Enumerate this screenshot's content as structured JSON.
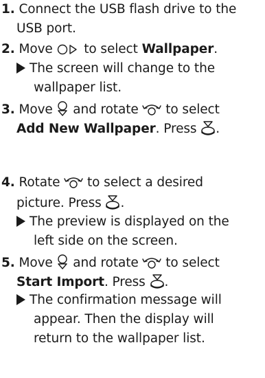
{
  "steps": [
    {
      "number": "1.",
      "line1": "Connect the USB flash drive to the",
      "line2": "USB port."
    },
    {
      "number": "2.",
      "text_before": "Move",
      "icon": "move-right-icon",
      "text_mid": "to select",
      "bold": "Wallpaper",
      "text_after": ".",
      "result_line1": "The screen will change to the",
      "result_line2": "wallpaper list."
    },
    {
      "number": "3.",
      "text_before": "Move",
      "icon1": "move-down-icon",
      "text_mid": "and rotate",
      "icon2": "rotate-icon",
      "text_after": "to select",
      "bold": "Add New Wallpaper",
      "text_press": ". Press",
      "icon3": "press-icon",
      "text_end": "."
    },
    {
      "number": "4.",
      "text_before": "Rotate",
      "icon": "rotate-icon",
      "text_after": "to select a desired",
      "line2_before": "picture. Press",
      "icon2": "press-icon",
      "line2_end": ".",
      "result_line1": "The preview is displayed on the",
      "result_line2": "left side on the screen."
    },
    {
      "number": "5.",
      "text_before": "Move",
      "icon1": "move-down-icon",
      "text_mid": "and rotate",
      "icon2": "rotate-icon",
      "text_after": "to select",
      "bold": "Start Import",
      "text_press": ". Press",
      "icon3": "press-icon",
      "text_end": ".",
      "result_line1": "The confirmation message will",
      "result_line2": "appear. Then the display will",
      "result_line3": "return to the wallpaper list."
    }
  ]
}
